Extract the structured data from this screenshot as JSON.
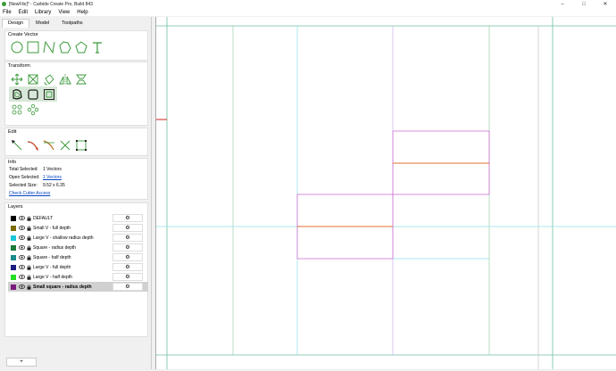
{
  "window": {
    "title": "[NewFile]* - Carbide Create Pro, Build 843",
    "controls": [
      "–",
      "□",
      "✕"
    ]
  },
  "menu": [
    "File",
    "Edit",
    "Library",
    "View",
    "Help"
  ],
  "tabs": [
    "Design",
    "Model",
    "Toolpaths"
  ],
  "create_vector": {
    "heading": "Create Vector",
    "tools": [
      "circle-tool",
      "rectangle-tool",
      "polyline-tool",
      "polygon-tool",
      "pentagon-tool",
      "text-tool"
    ]
  },
  "transform": {
    "heading": "Transform",
    "tools": [
      "move-tool",
      "scale-tool",
      "rotate-tool",
      "mirror-tool",
      "align-tool",
      "offset-tool",
      "boolean-tool",
      "group-tool",
      "array-tool",
      "circular-array-tool"
    ]
  },
  "edit": {
    "heading": "Edit",
    "tools": [
      "node-edit-tool",
      "fillet-tool",
      "trim-tool",
      "cut-tool",
      "join-tool"
    ]
  },
  "info": {
    "heading": "Info",
    "total_selected_label": "Total Selected:",
    "total_selected_value": "1 Vectors",
    "open_selected_label": "Open Selected:",
    "open_selected_value": "1 Vectors",
    "selected_size_label": "Selected Size:",
    "selected_size_value": "9.52 x 6.35",
    "check_cutter": "Check Cutter Access"
  },
  "layers": {
    "heading": "Layers",
    "add_label": "+",
    "items": [
      {
        "name": "DEFAULT",
        "color": "#000000",
        "selected": false
      },
      {
        "name": "Small V - full depth",
        "color": "#7a6a00",
        "selected": false
      },
      {
        "name": "Large V - shallow radius depth",
        "color": "#19c8d8",
        "selected": false
      },
      {
        "name": "Square - radius depth",
        "color": "#1a7a3a",
        "selected": false
      },
      {
        "name": "Square - half depth",
        "color": "#1a8a8a",
        "selected": false
      },
      {
        "name": "Large V - full depth",
        "color": "#1a1a80",
        "selected": false
      },
      {
        "name": "Large V - half depth",
        "color": "#22dd22",
        "selected": false
      },
      {
        "name": "Small square - radius depth",
        "color": "#7a1a7a",
        "selected": true
      }
    ]
  },
  "colors": {
    "accent": "#3a9a3a",
    "selection_orange": "#e07030",
    "pink": "#d070d0"
  }
}
